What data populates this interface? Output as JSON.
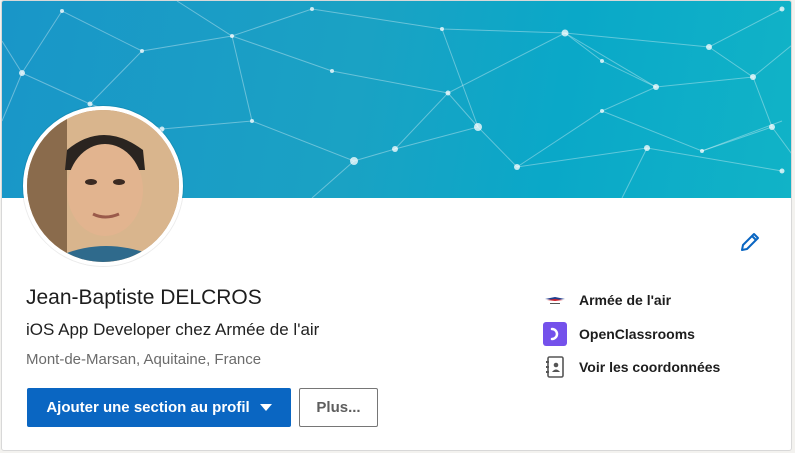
{
  "profile": {
    "name": "Jean-Baptiste DELCROS",
    "headline": "iOS App Developer chez Armée de l'air",
    "location": "Mont-de-Marsan, Aquitaine, France"
  },
  "actions": {
    "add_section_label": "Ajouter une section au profil",
    "more_label": "Plus..."
  },
  "sidebar": {
    "items": [
      {
        "label": "Armée de l'air",
        "icon": "armee-de-lair-logo"
      },
      {
        "label": "OpenClassrooms",
        "icon": "openclassrooms-logo"
      },
      {
        "label": "Voir les coordonnées",
        "icon": "contact-card-icon"
      }
    ]
  },
  "colors": {
    "primary_button": "#0a66c2",
    "edit_icon": "#0a66c2",
    "openclassrooms": "#7451eb"
  }
}
